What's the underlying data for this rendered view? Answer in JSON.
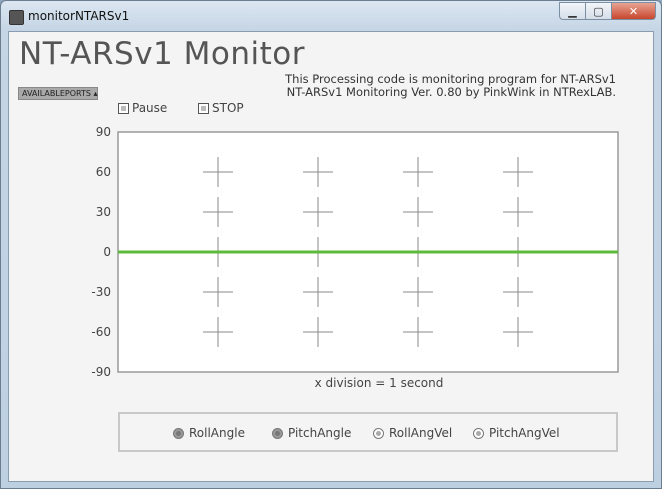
{
  "window": {
    "title": "monitorNTARSv1",
    "min_icon": "minimize-icon",
    "max_icon": "maximize-icon",
    "close_icon": "close-icon"
  },
  "header": {
    "title": "NT-ARSv1 Monitor",
    "description_line1": "This Processing code is monitoring program for NT-ARSv1",
    "description_line2": "NT-ARSv1 Monitoring Ver. 0.80 by PinkWink in NTRexLAB."
  },
  "ports": {
    "label": "AVAILABLEPORTS ▴"
  },
  "controls": {
    "pause_label": "Pause",
    "stop_label": "STOP"
  },
  "chart_data": {
    "type": "line",
    "ylim": [
      -90,
      90
    ],
    "yticks": [
      "90",
      "60",
      "30",
      "0",
      "-30",
      "-60",
      "-90"
    ],
    "xlabel": "x division = 1 second",
    "series": [
      {
        "values": [
          0,
          0
        ],
        "color": "#5dbb3c"
      }
    ],
    "grid": "crosshair markers"
  },
  "toggles": [
    {
      "label": "RollAngle",
      "checked": true
    },
    {
      "label": "PitchAngle",
      "checked": true
    },
    {
      "label": "RollAngVel",
      "checked": false
    },
    {
      "label": "PitchAngVel",
      "checked": false
    }
  ]
}
